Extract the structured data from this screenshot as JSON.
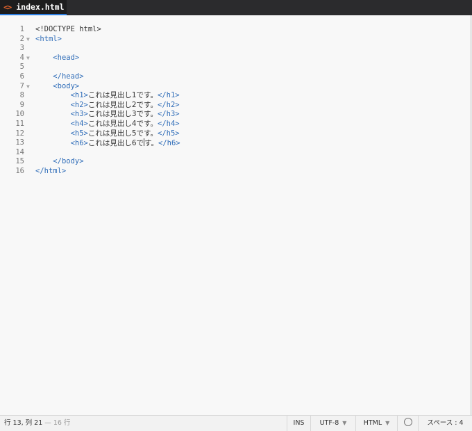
{
  "tab": {
    "icon": "<>",
    "label": "index.html"
  },
  "editor": {
    "line_numbers": [
      "1",
      "2",
      "3",
      "4",
      "5",
      "6",
      "7",
      "8",
      "9",
      "10",
      "11",
      "12",
      "13",
      "14",
      "15",
      "16"
    ],
    "code": {
      "l1": "<!DOCTYPE html>",
      "l2": "<html>",
      "l4": "<head>",
      "l6": "</head>",
      "l7": "<body>",
      "h1_open": "<h1>",
      "h1_text": "これは見出し1です。",
      "h1_close": "</h1>",
      "h2_open": "<h2>",
      "h2_text": "これは見出し2です。",
      "h2_close": "</h2>",
      "h3_open": "<h3>",
      "h3_text": "これは見出し3です。",
      "h3_close": "</h3>",
      "h4_open": "<h4>",
      "h4_text": "これは見出し4です。",
      "h4_close": "</h4>",
      "h5_open": "<h5>",
      "h5_text": "これは見出し5です。",
      "h5_close": "</h5>",
      "h6_open": "<h6>",
      "h6_text_a": "これは見出し6で",
      "h6_text_b": "す。",
      "h6_close": "</h6>",
      "l15": "</body>",
      "l16": "</html>"
    }
  },
  "statusbar": {
    "position": "行 13, 列 21",
    "line_count": "— 16 行",
    "mode": "INS",
    "encoding": "UTF-8",
    "language": "HTML",
    "indent": "スペース : 4"
  },
  "colors": {
    "tag": "#2e6cb8",
    "tab_icon": "#e2632c",
    "tab_underline": "#2b7de1"
  }
}
